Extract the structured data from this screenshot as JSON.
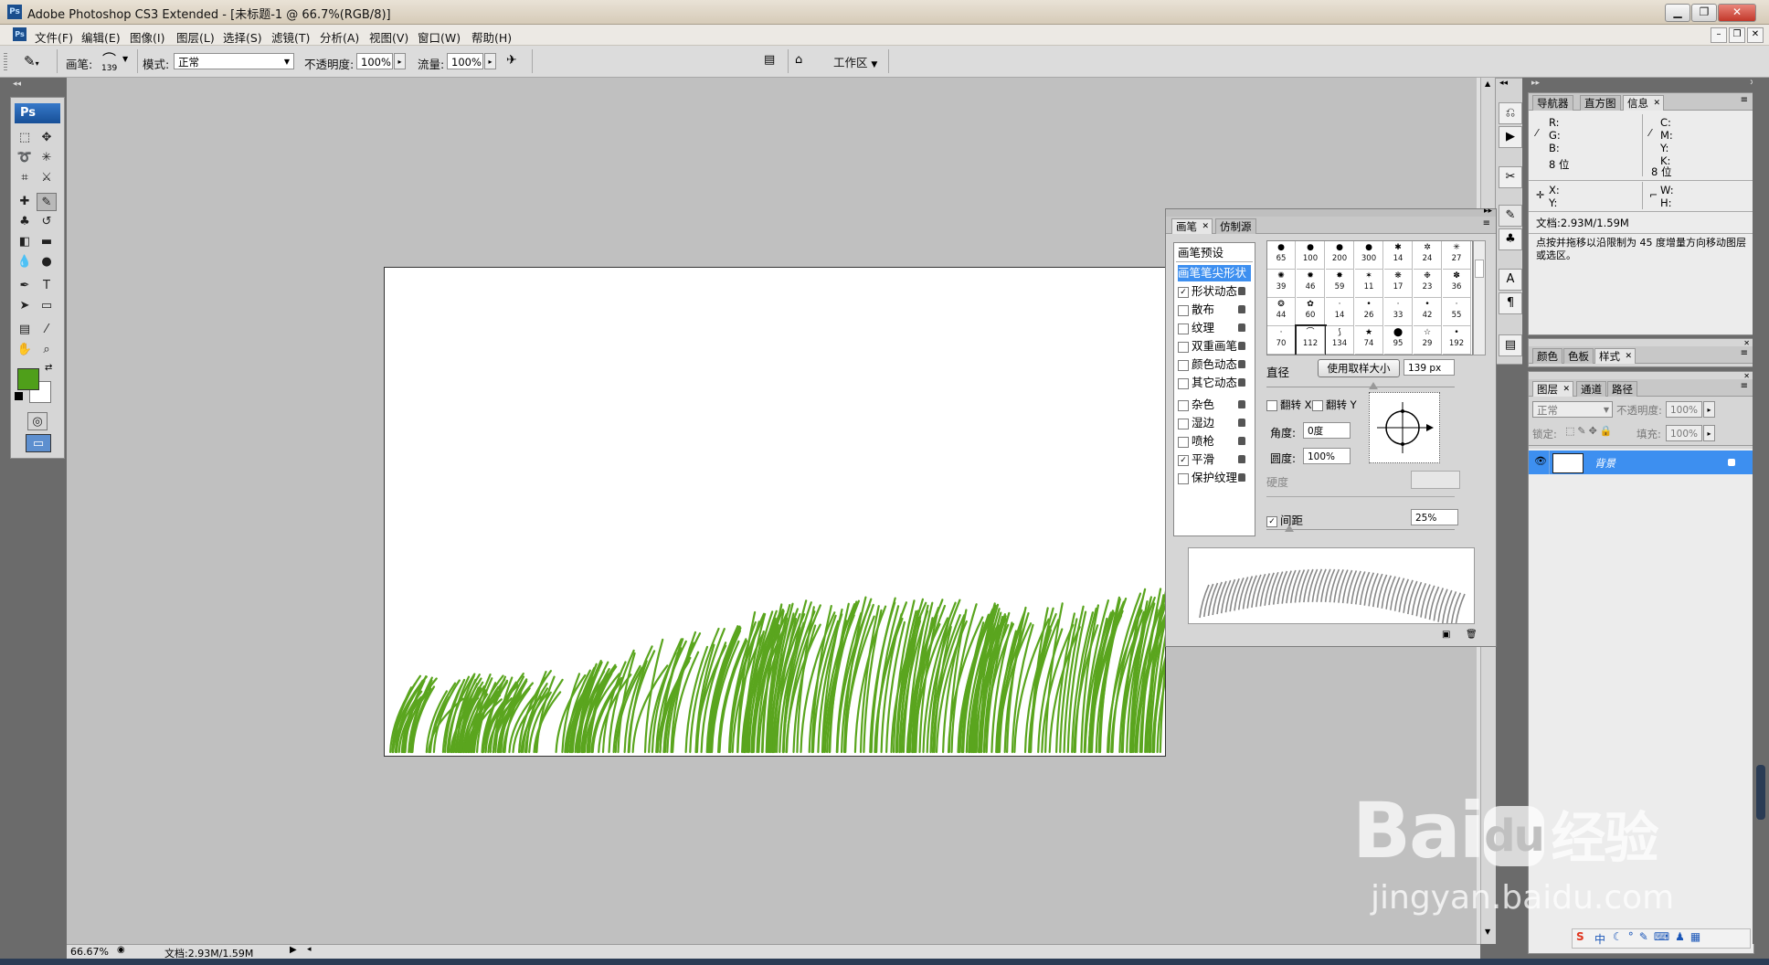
{
  "window": {
    "title": "Adobe Photoshop CS3 Extended - [未标题-1 @ 66.7%(RGB/8)]",
    "app_icon": "Ps"
  },
  "menu": [
    "文件(F)",
    "编辑(E)",
    "图像(I)",
    "图层(L)",
    "选择(S)",
    "滤镜(T)",
    "分析(A)",
    "视图(V)",
    "窗口(W)",
    "帮助(H)"
  ],
  "options": {
    "brush_label": "画笔:",
    "brush_size": "139",
    "mode_label": "模式:",
    "mode_value": "正常",
    "opacity_label": "不透明度:",
    "opacity_value": "100%",
    "flow_label": "流量:",
    "flow_value": "100%",
    "workspace_label": "工作区"
  },
  "toolbox": {
    "logo": "Ps",
    "foreground_color": "#4f9f1a",
    "background_color": "#ffffff"
  },
  "status": {
    "zoom": "66.67%",
    "doc": "文档:2.93M/1.59M"
  },
  "brush_panel": {
    "tabs": [
      "画笔",
      "仿制源"
    ],
    "presets_header": "画笔预设",
    "options": [
      {
        "label": "画笔笔尖形状",
        "checked": null,
        "selected": true
      },
      {
        "label": "形状动态",
        "checked": true
      },
      {
        "label": "散布",
        "checked": false
      },
      {
        "label": "纹理",
        "checked": false
      },
      {
        "label": "双重画笔",
        "checked": false
      },
      {
        "label": "颜色动态",
        "checked": false
      },
      {
        "label": "其它动态",
        "checked": false
      },
      {
        "label": "杂色",
        "checked": false
      },
      {
        "label": "湿边",
        "checked": false
      },
      {
        "label": "喷枪",
        "checked": false
      },
      {
        "label": "平滑",
        "checked": true
      },
      {
        "label": "保护纹理",
        "checked": false
      }
    ],
    "brush_sizes": [
      "65",
      "100",
      "200",
      "300",
      "14",
      "24",
      "27",
      "39",
      "46",
      "59",
      "11",
      "17",
      "23",
      "36",
      "44",
      "60",
      "14",
      "26",
      "33",
      "42",
      "55",
      "70",
      "112",
      "134",
      "74",
      "95",
      "29",
      "192"
    ],
    "diameter_label": "直径",
    "use_sample_label": "使用取样大小",
    "diameter_value": "139 px",
    "flip_x": "翻转 X",
    "flip_y": "翻转 Y",
    "angle_label": "角度:",
    "angle_value": "0度",
    "roundness_label": "圆度:",
    "roundness_value": "100%",
    "hardness_label": "硬度",
    "spacing_label": "间距",
    "spacing_checked": true,
    "spacing_value": "25%"
  },
  "info_panel": {
    "tabs": [
      "导航器",
      "直方图",
      "信息"
    ],
    "rgb": [
      "R:",
      "G:",
      "B:"
    ],
    "cmyk": [
      "C:",
      "M:",
      "Y:",
      "K:"
    ],
    "bit_left": "8 位",
    "bit_right": "8 位",
    "xy": [
      "X:",
      "Y:"
    ],
    "wh": [
      "W:",
      "H:"
    ],
    "doc": "文档:2.93M/1.59M",
    "hint": "点按并拖移以沿限制为 45 度增量方向移动图层或选区。"
  },
  "color_panel": {
    "tabs": [
      "颜色",
      "色板",
      "样式"
    ]
  },
  "layers_panel": {
    "tabs": [
      "图层",
      "通道",
      "路径"
    ],
    "mode": "正常",
    "opacity_label": "不透明度:",
    "opacity_value": "100%",
    "lock_label": "锁定:",
    "fill_label": "填充:",
    "fill_value": "100%",
    "layer_name": "背景"
  },
  "watermark": {
    "brand": "Bai",
    "brand_sub": "经验",
    "url": "jingyan.baidu.com"
  },
  "ime": {
    "label": "中"
  }
}
